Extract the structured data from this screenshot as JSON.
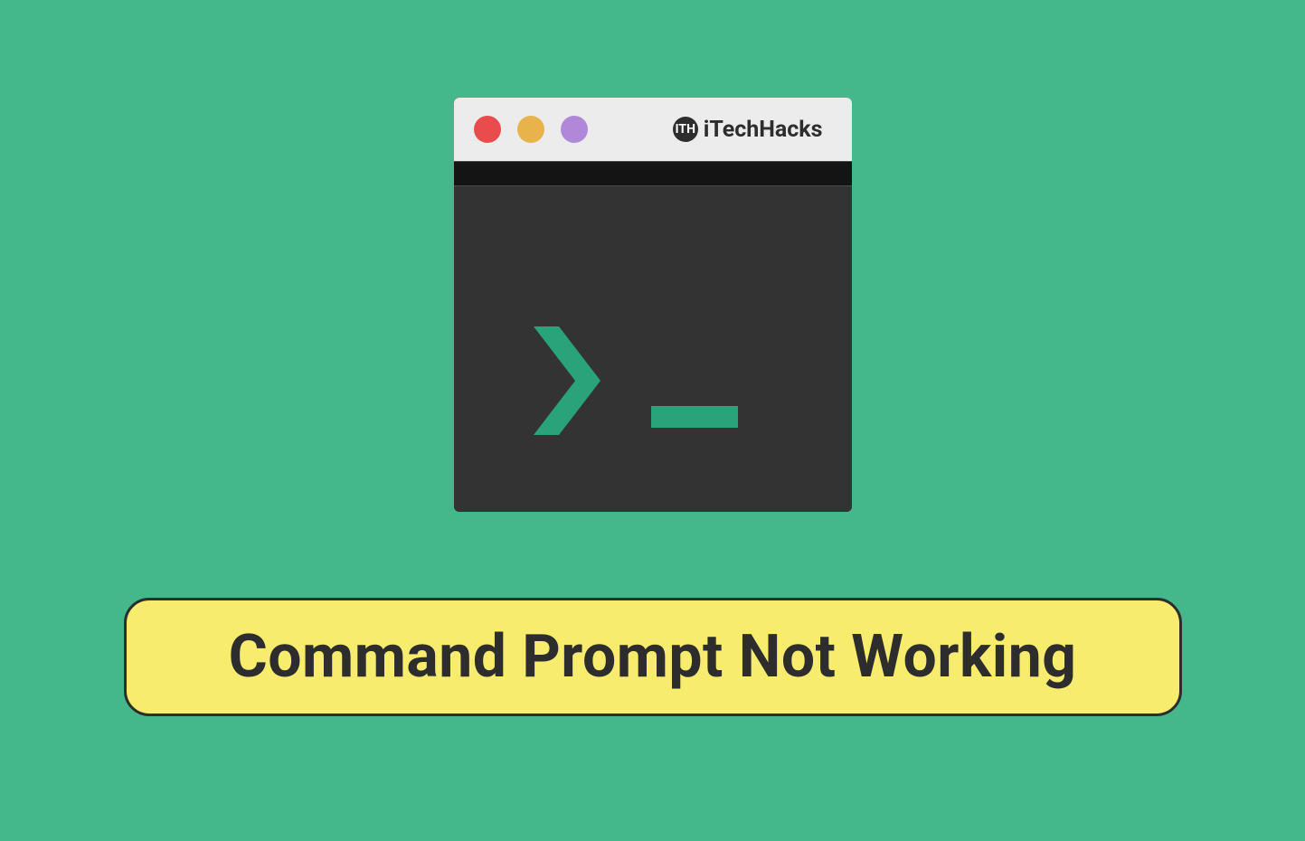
{
  "brand": {
    "icon_label": "ITH",
    "name": "iTechHacks"
  },
  "colors": {
    "background": "#44b78b",
    "terminal_body": "#333333",
    "title_bar": "#ececec",
    "traffic_red": "#e94c4c",
    "traffic_yellow": "#e9b34c",
    "traffic_purple": "#b088d9",
    "prompt_accent": "#2aa37a",
    "badge_bg": "#f7ec6e",
    "text_dark": "#2d2d2d"
  },
  "headline": "Command Prompt Not Working"
}
